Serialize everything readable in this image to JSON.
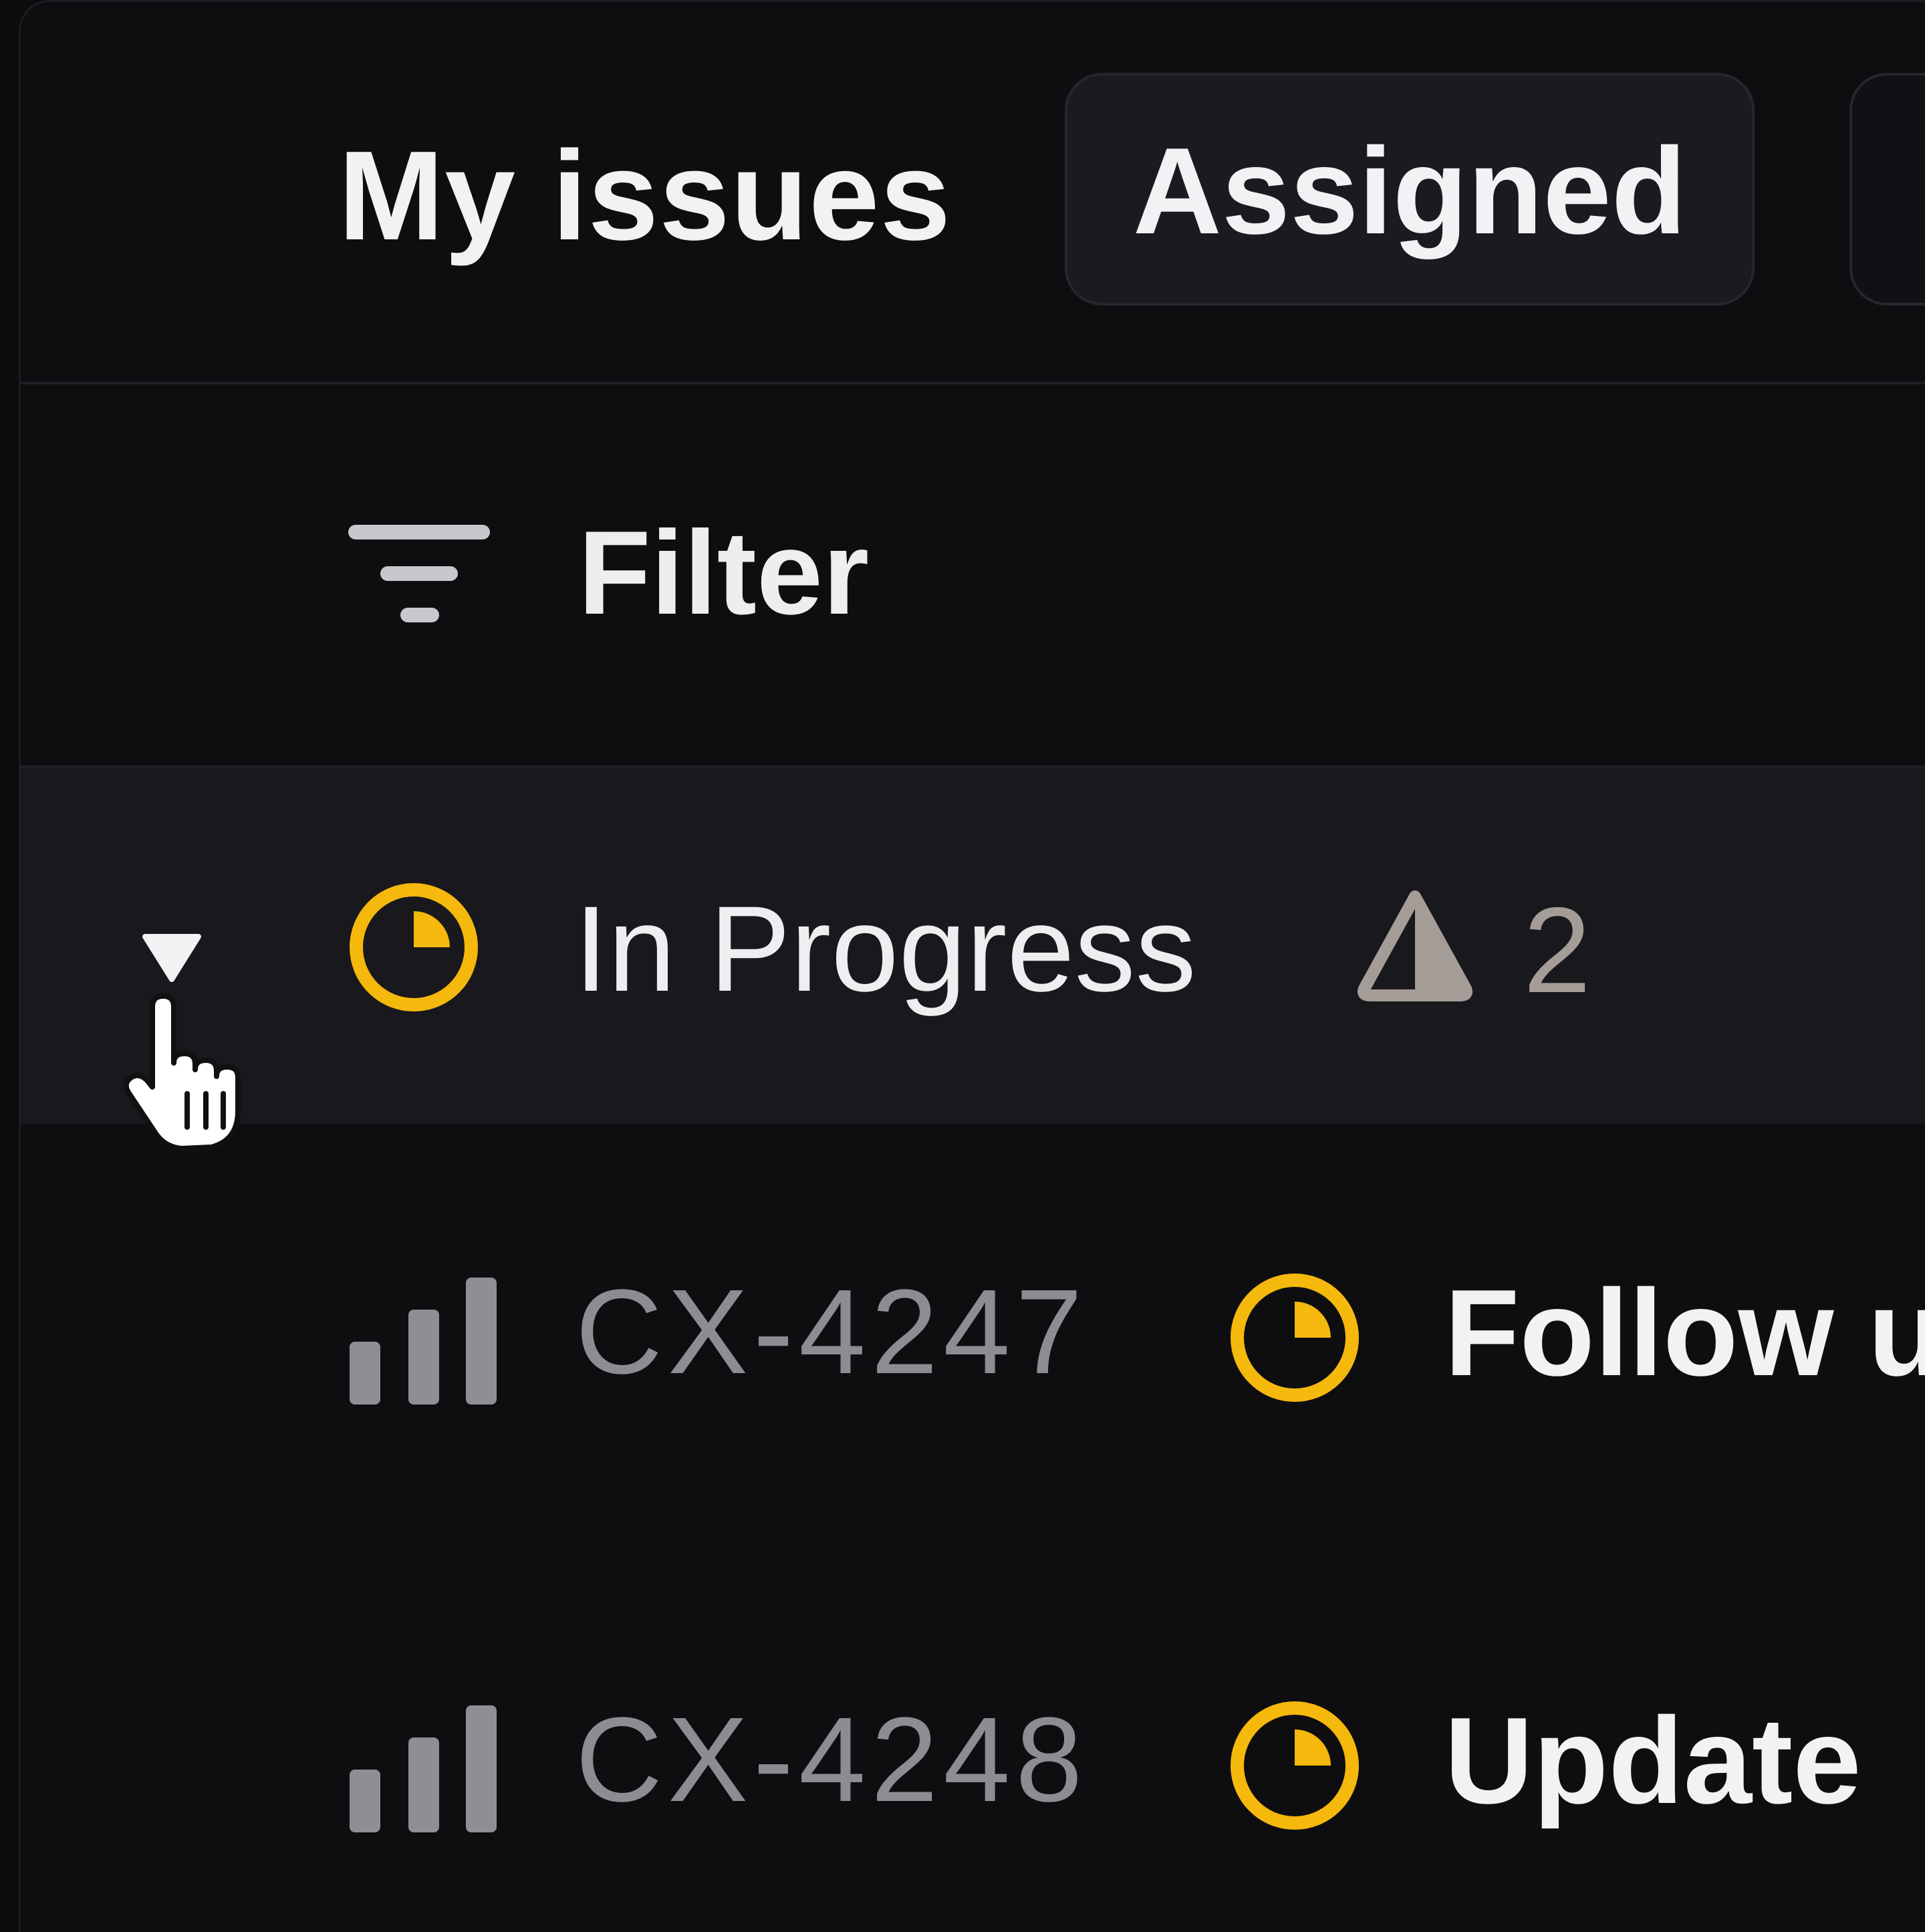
{
  "header": {
    "title": "My issues",
    "tabs": [
      {
        "label": "Assigned",
        "active": true
      }
    ]
  },
  "filter": {
    "label": "Filter",
    "icon": "filter-lines-icon"
  },
  "group": {
    "label": "In Progress",
    "status_icon": "in-progress-icon",
    "warning_icon": "warning-icon",
    "count": "2",
    "expanded": true
  },
  "issues": [
    {
      "id": "CX-4247",
      "title": "Follow u",
      "priority_icon": "priority-bars-icon",
      "status_icon": "in-progress-icon"
    },
    {
      "id": "CX-4248",
      "title": "Update",
      "priority_icon": "priority-bars-icon",
      "status_icon": "in-progress-icon"
    }
  ],
  "colors": {
    "background": "#0e0d10",
    "group_background": "#19181c",
    "tab_background": "#1b1a20",
    "in_progress": "#f5b80c",
    "muted_text": "#8c8c92",
    "warning": "#a49c96"
  }
}
